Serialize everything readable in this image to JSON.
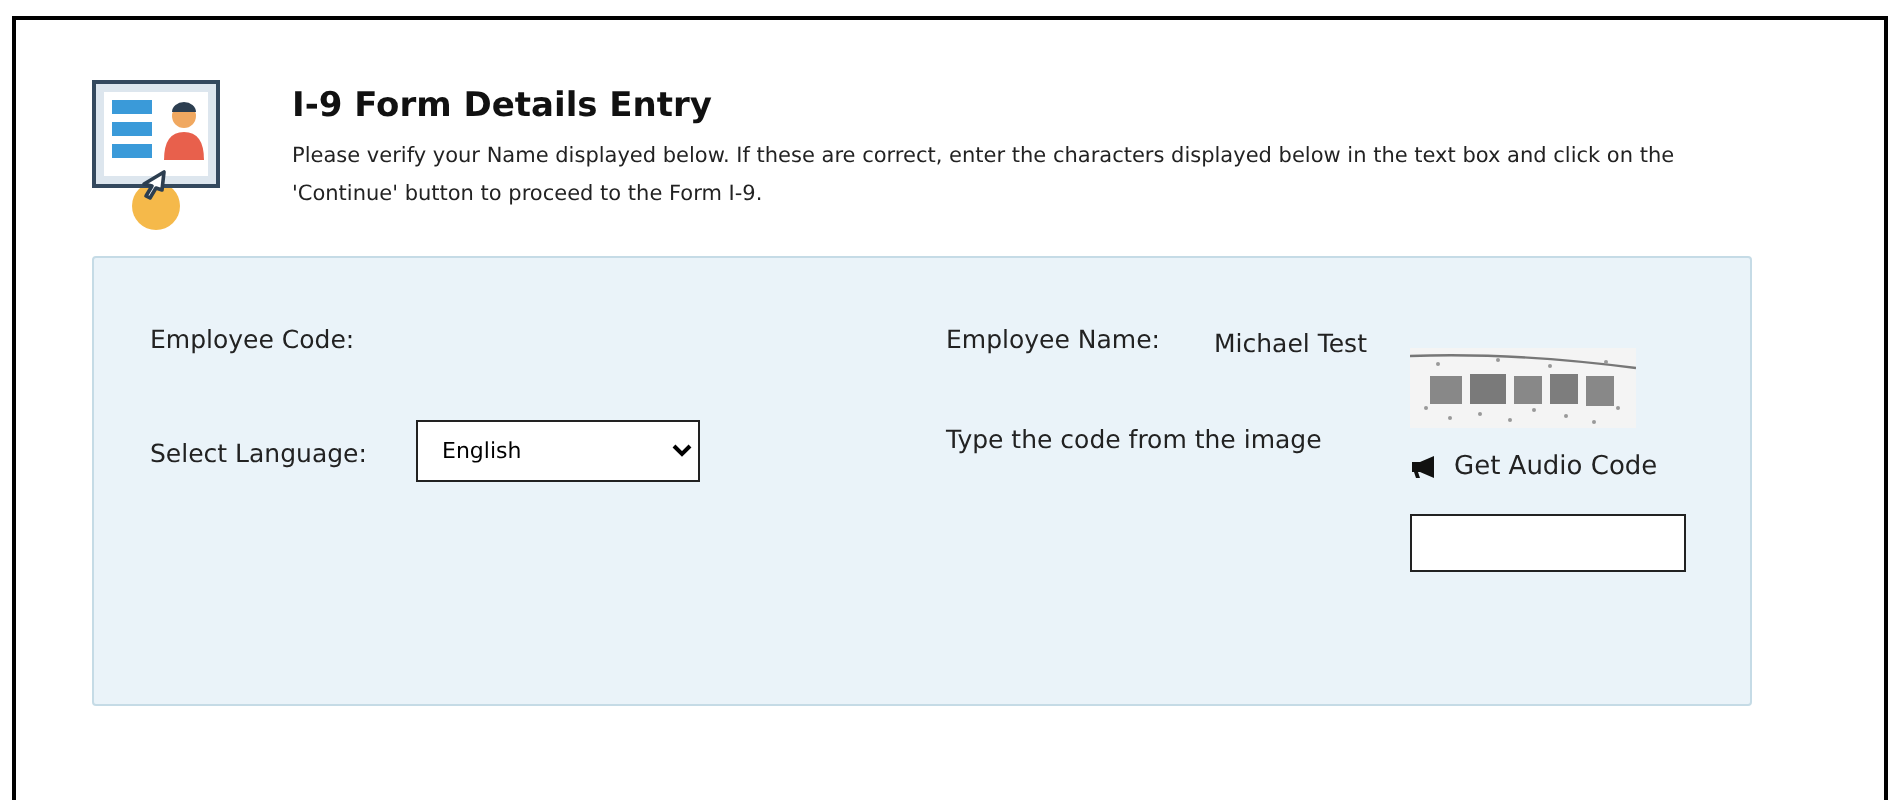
{
  "header": {
    "title": "I-9 Form Details Entry",
    "description": "Please verify your Name displayed below. If these are correct, enter the characters displayed below in the text box and click on the 'Continue' button to proceed to the Form I-9."
  },
  "form": {
    "employee_code": {
      "label": "Employee Code:"
    },
    "language": {
      "label": "Select Language:",
      "value": "English"
    },
    "employee_name": {
      "label": "Employee Name:",
      "value": "Michael Test"
    },
    "captcha": {
      "label": "Type the code from the image",
      "audio_link": "Get Audio Code"
    }
  }
}
